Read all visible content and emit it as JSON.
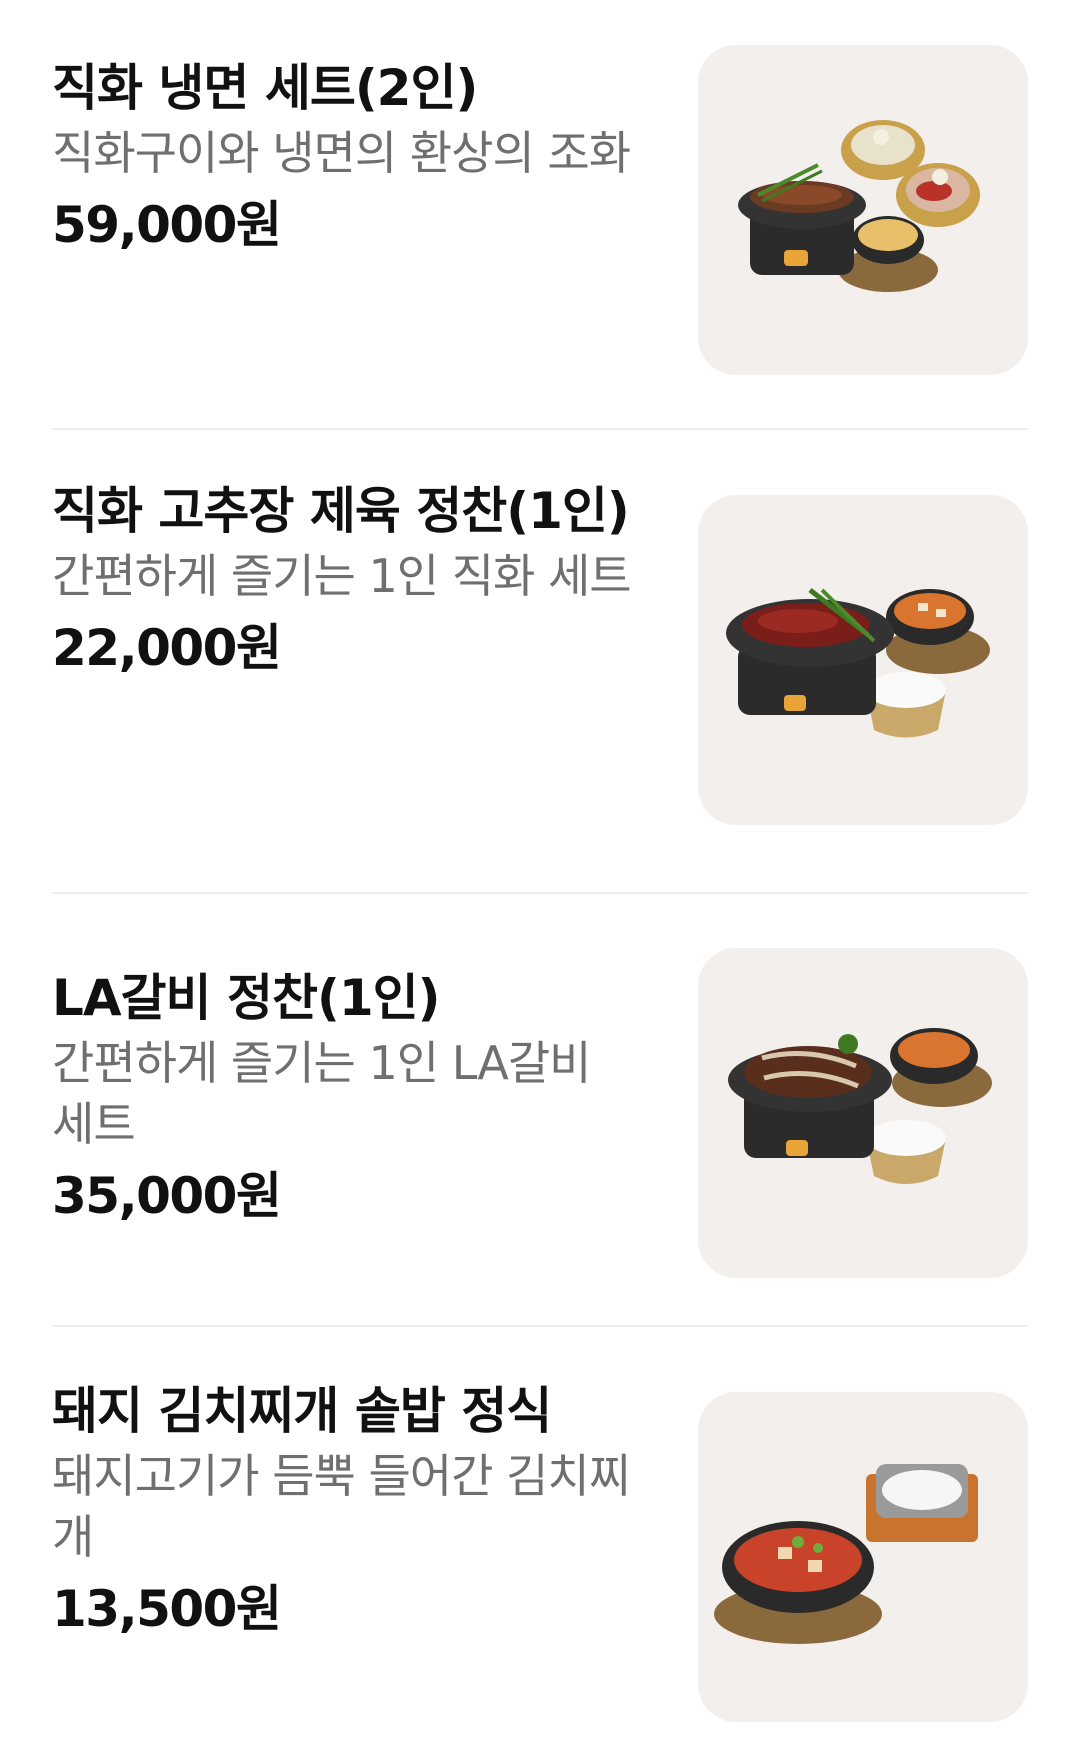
{
  "menu": {
    "items": [
      {
        "title": "직화 냉면 세트(2인)",
        "description": "직화구이와 냉면의 환상의 조화",
        "price": "59,000원",
        "image_icon": "bulgogi-naengmyeon-set-photo"
      },
      {
        "title": "직화 고추장 제육 정찬(1인)",
        "description": "간편하게 즐기는 1인 직화 세트",
        "price": "22,000원",
        "image_icon": "spicy-pork-set-photo"
      },
      {
        "title": "LA갈비 정찬(1인)",
        "description": "간편하게 즐기는 1인 LA갈비 세트",
        "price": "35,000원",
        "image_icon": "la-galbi-set-photo"
      },
      {
        "title": "돼지 김치찌개 솥밥 정식",
        "description": "돼지고기가 듬뿍 들어간 김치찌개",
        "price": "13,500원",
        "image_icon": "kimchi-stew-set-photo"
      }
    ]
  }
}
